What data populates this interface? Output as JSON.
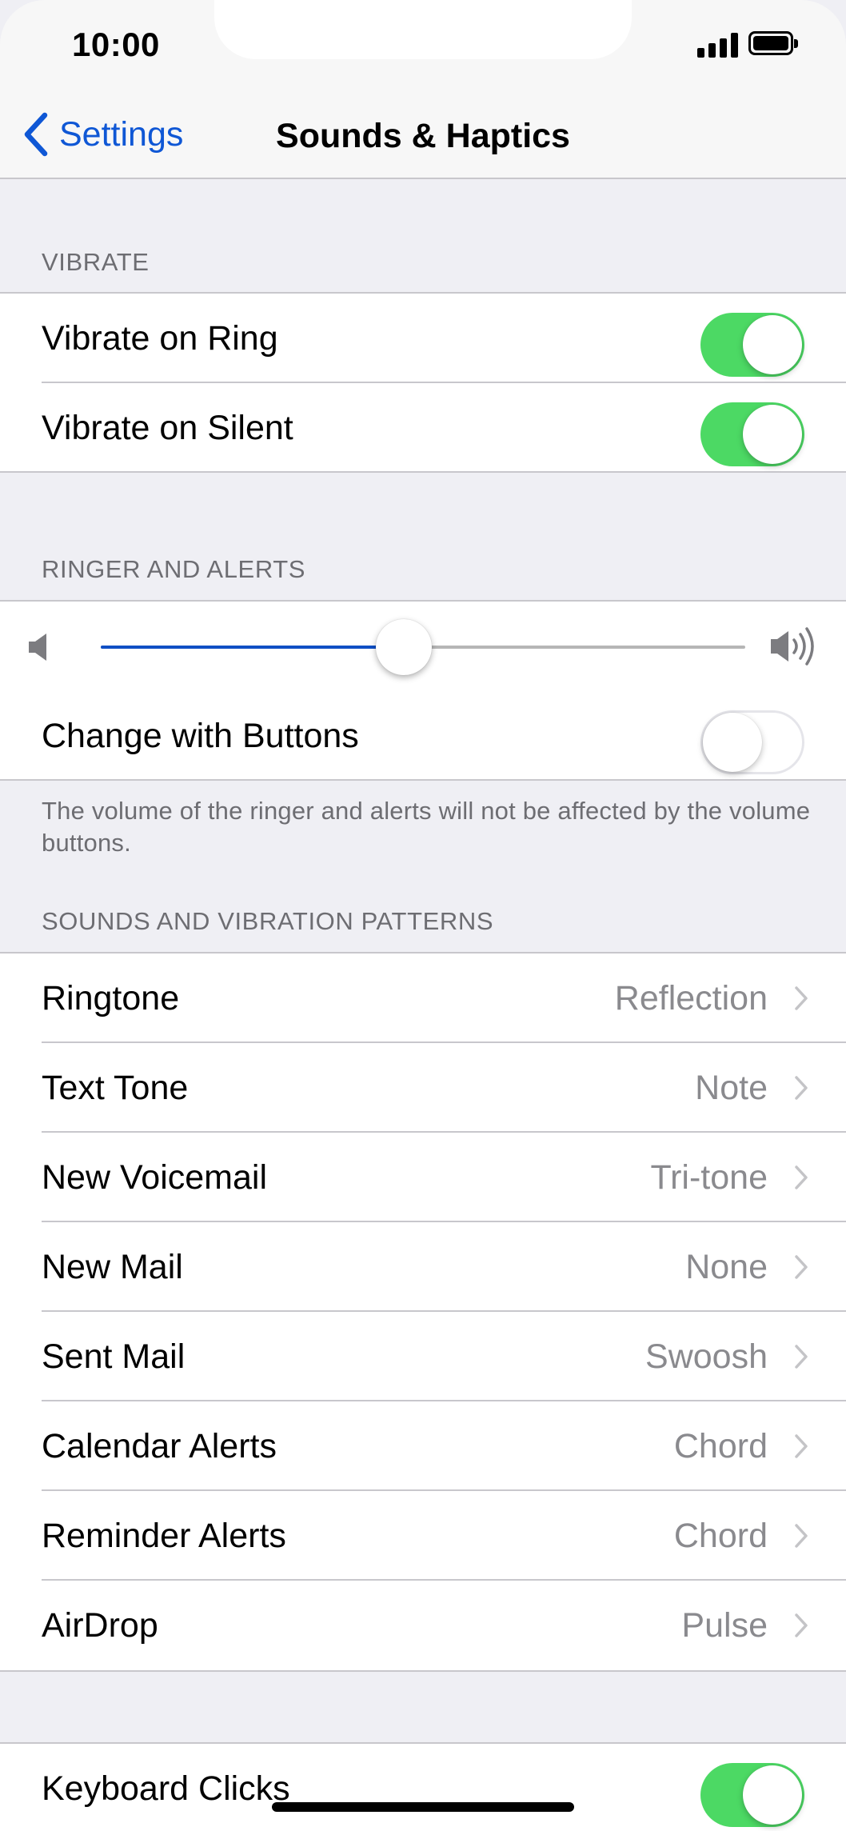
{
  "status_bar": {
    "time": "10:00"
  },
  "nav": {
    "back_label": "Settings",
    "title": "Sounds & Haptics"
  },
  "vibrate": {
    "header": "VIBRATE",
    "rows": [
      {
        "label": "Vibrate on Ring",
        "on": true
      },
      {
        "label": "Vibrate on Silent",
        "on": true
      }
    ]
  },
  "ringer": {
    "header": "RINGER AND ALERTS",
    "volume_level": 0.47,
    "change_with_buttons": {
      "label": "Change with Buttons",
      "on": false
    },
    "footnote": "The volume of the ringer and alerts will not be affected by the volume buttons."
  },
  "sounds": {
    "header": "SOUNDS AND VIBRATION PATTERNS",
    "rows": [
      {
        "label": "Ringtone",
        "value": "Reflection"
      },
      {
        "label": "Text Tone",
        "value": "Note"
      },
      {
        "label": "New Voicemail",
        "value": "Tri-tone"
      },
      {
        "label": "New Mail",
        "value": "None"
      },
      {
        "label": "Sent Mail",
        "value": "Swoosh"
      },
      {
        "label": "Calendar Alerts",
        "value": "Chord"
      },
      {
        "label": "Reminder Alerts",
        "value": "Chord"
      },
      {
        "label": "AirDrop",
        "value": "Pulse"
      }
    ]
  },
  "keyboard": {
    "label": "Keyboard Clicks",
    "on": true
  },
  "colors": {
    "accent": "#0f57d5",
    "toggle_on": "#4cd964",
    "slider_fill": "#0f4fc4"
  }
}
